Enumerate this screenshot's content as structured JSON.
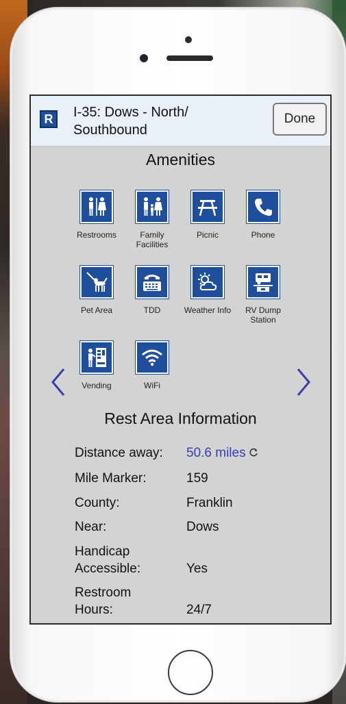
{
  "header": {
    "logo_letter": "R",
    "title": "I-35: Dows - North/ Southbound",
    "done_label": "Done"
  },
  "amenities": {
    "heading": "Amenities",
    "items": [
      {
        "label": "Restrooms",
        "icon": "restrooms-icon"
      },
      {
        "label": "Family Facilities",
        "icon": "family-facilities-icon"
      },
      {
        "label": "Picnic",
        "icon": "picnic-table-icon"
      },
      {
        "label": "Phone",
        "icon": "phone-icon"
      },
      {
        "label": "Pet Area",
        "icon": "pet-area-icon"
      },
      {
        "label": "TDD",
        "icon": "tdd-icon"
      },
      {
        "label": "Weather Info",
        "icon": "weather-icon"
      },
      {
        "label": "RV Dump Station",
        "icon": "rv-dump-icon"
      },
      {
        "label": "Vending",
        "icon": "vending-icon"
      },
      {
        "label": "WiFi",
        "icon": "wifi-icon"
      }
    ]
  },
  "info": {
    "heading": "Rest Area Information",
    "distance_label": "Distance away:",
    "distance_value": "50.6 miles",
    "mile_marker_label": "Mile Marker:",
    "mile_marker_value": "159",
    "county_label": "County:",
    "county_value": "Franklin",
    "near_label": "Near:",
    "near_value": "Dows",
    "handicap_label_1": "Handicap",
    "handicap_label_2": "Accessible:",
    "handicap_value": "Yes",
    "restroom_label_1": "Restroom",
    "restroom_label_2": "Hours:",
    "restroom_value": "24/7"
  },
  "colors": {
    "sign_blue": "#1f4e9c",
    "link_blue": "#3a3ea8",
    "header_bg": "#eaf0f7",
    "screen_bg": "#d3d3d3"
  }
}
